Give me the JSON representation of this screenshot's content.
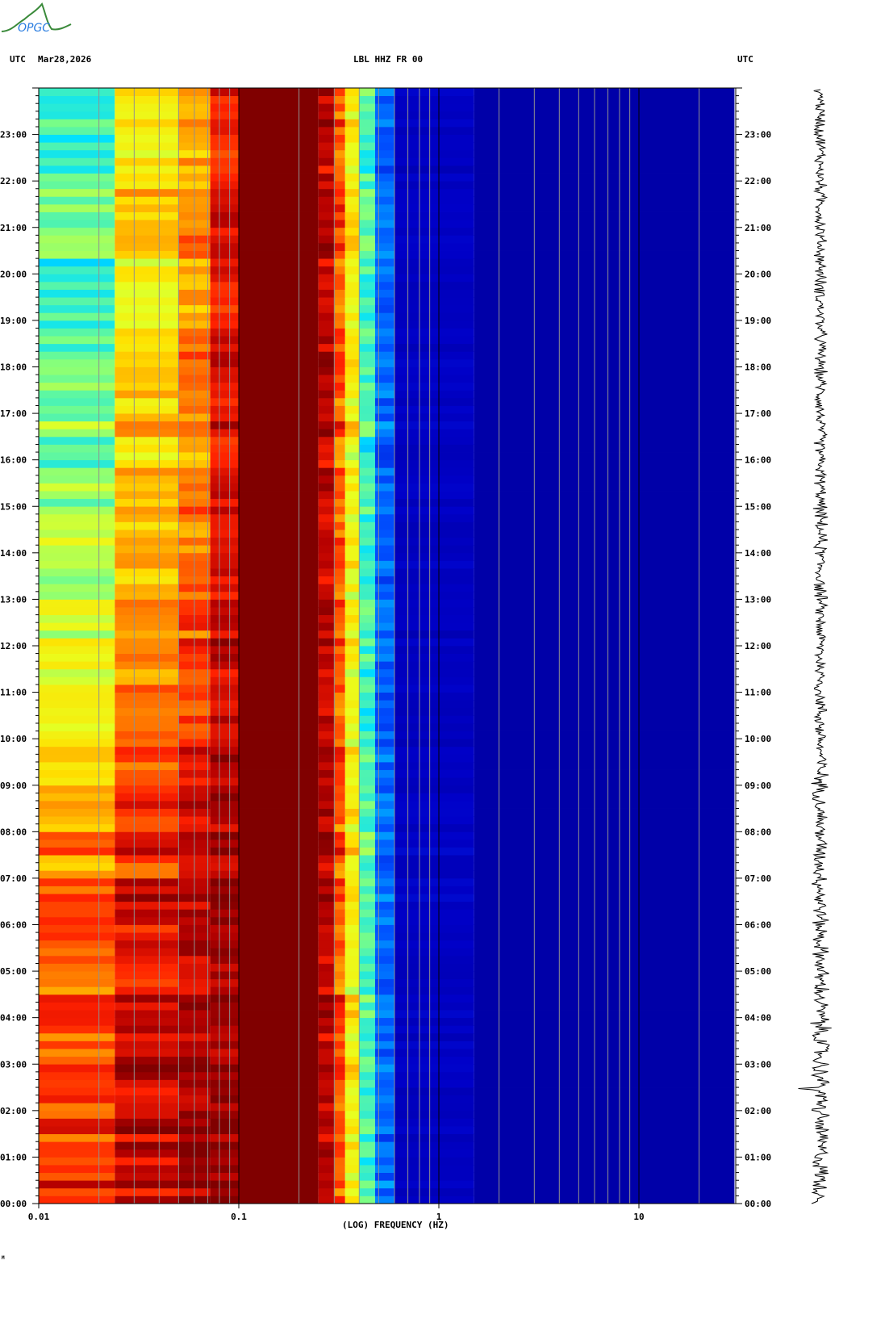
{
  "logo": {
    "text": "OPGC"
  },
  "header": {
    "left_tz": "UTC",
    "date": "Mar28,2026",
    "station": "LBL HHZ FR 00",
    "right_tz": "UTC"
  },
  "footer": {
    "mark": "M"
  },
  "chart_data": {
    "type": "heatmap",
    "title": "LBL HHZ FR 00",
    "xlabel": "(LOG) FREQUENCY (HZ)",
    "ylabel": "UTC",
    "xscale": "log",
    "xlim": [
      0.01,
      30
    ],
    "ylim_hours": [
      0,
      24
    ],
    "x_tick_labels": [
      "0.01",
      "0.1",
      "1",
      "10"
    ],
    "x_tick_values": [
      0.01,
      0.1,
      1,
      10
    ],
    "y_tick_labels": [
      "00:00",
      "01:00",
      "02:00",
      "03:00",
      "04:00",
      "05:00",
      "06:00",
      "07:00",
      "08:00",
      "09:00",
      "10:00",
      "11:00",
      "12:00",
      "13:00",
      "14:00",
      "15:00",
      "16:00",
      "17:00",
      "18:00",
      "19:00",
      "20:00",
      "21:00",
      "22:00",
      "23:00"
    ],
    "minor_tick_minutes": 10,
    "colorscale": "jet (low = dark blue, high = dark red)",
    "grid": true,
    "bands": [
      {
        "f": [
          0.01,
          0.024
        ],
        "noise": 0.08,
        "hourly_level": [
          0.86,
          0.85,
          0.85,
          0.84,
          0.84,
          0.83,
          0.8,
          0.76,
          0.72,
          0.7,
          0.67,
          0.64,
          0.6,
          0.58,
          0.56,
          0.52,
          0.5,
          0.48,
          0.47,
          0.46,
          0.45,
          0.45,
          0.44,
          0.44
        ]
      },
      {
        "f": [
          0.024,
          0.05
        ],
        "noise": 0.09,
        "hourly_level": [
          0.93,
          0.93,
          0.92,
          0.92,
          0.91,
          0.9,
          0.88,
          0.85,
          0.83,
          0.82,
          0.8,
          0.78,
          0.75,
          0.74,
          0.72,
          0.71,
          0.7,
          0.68,
          0.67,
          0.67,
          0.66,
          0.66,
          0.65,
          0.65
        ]
      },
      {
        "f": [
          0.05,
          0.072
        ],
        "noise": 0.08,
        "hourly_level": [
          0.97,
          0.97,
          0.96,
          0.96,
          0.95,
          0.94,
          0.93,
          0.91,
          0.9,
          0.89,
          0.87,
          0.85,
          0.83,
          0.82,
          0.8,
          0.8,
          0.79,
          0.78,
          0.77,
          0.76,
          0.76,
          0.75,
          0.75,
          0.74
        ]
      },
      {
        "f": [
          0.072,
          0.1
        ],
        "noise": 0.06,
        "hourly_level": [
          0.98,
          0.98,
          0.98,
          0.97,
          0.97,
          0.97,
          0.96,
          0.95,
          0.95,
          0.94,
          0.94,
          0.93,
          0.92,
          0.92,
          0.91,
          0.91,
          0.9,
          0.9,
          0.9,
          0.89,
          0.89,
          0.89,
          0.88,
          0.88
        ]
      },
      {
        "f": [
          0.1,
          0.25
        ],
        "noise": 0.0,
        "hourly_level": [
          1,
          1,
          1,
          1,
          1,
          1,
          1,
          1,
          1,
          1,
          1,
          1,
          1,
          1,
          1,
          1,
          1,
          1,
          1,
          1,
          1,
          1,
          1,
          1
        ]
      },
      {
        "f": [
          0.25,
          0.3
        ],
        "noise": 0.06,
        "hourly_level": [
          0.94,
          0.94,
          0.94,
          0.94,
          0.94,
          0.94,
          0.94,
          0.94,
          0.94,
          0.94,
          0.94,
          0.94,
          0.94,
          0.94,
          0.94,
          0.94,
          0.94,
          0.94,
          0.94,
          0.94,
          0.94,
          0.94,
          0.94,
          0.94
        ]
      },
      {
        "f": [
          0.3,
          0.34
        ],
        "noise": 0.08,
        "hourly_level": [
          0.82,
          0.82,
          0.82,
          0.82,
          0.82,
          0.82,
          0.82,
          0.82,
          0.82,
          0.82,
          0.82,
          0.82,
          0.82,
          0.82,
          0.82,
          0.82,
          0.82,
          0.82,
          0.82,
          0.82,
          0.82,
          0.82,
          0.82,
          0.82
        ]
      },
      {
        "f": [
          0.34,
          0.4
        ],
        "noise": 0.08,
        "hourly_level": [
          0.64,
          0.64,
          0.64,
          0.64,
          0.64,
          0.64,
          0.64,
          0.64,
          0.64,
          0.64,
          0.64,
          0.64,
          0.64,
          0.64,
          0.64,
          0.64,
          0.64,
          0.64,
          0.64,
          0.64,
          0.64,
          0.64,
          0.64,
          0.64
        ]
      },
      {
        "f": [
          0.4,
          0.48
        ],
        "noise": 0.07,
        "hourly_level": [
          0.45,
          0.45,
          0.45,
          0.45,
          0.45,
          0.45,
          0.45,
          0.45,
          0.45,
          0.45,
          0.45,
          0.45,
          0.45,
          0.45,
          0.45,
          0.45,
          0.45,
          0.45,
          0.45,
          0.45,
          0.45,
          0.45,
          0.45,
          0.45
        ]
      },
      {
        "f": [
          0.48,
          0.6
        ],
        "noise": 0.05,
        "hourly_level": [
          0.27,
          0.27,
          0.27,
          0.27,
          0.27,
          0.27,
          0.27,
          0.27,
          0.27,
          0.27,
          0.27,
          0.27,
          0.27,
          0.27,
          0.27,
          0.27,
          0.27,
          0.27,
          0.27,
          0.27,
          0.27,
          0.27,
          0.27,
          0.27
        ]
      },
      {
        "f": [
          0.6,
          1.5
        ],
        "noise": 0.02,
        "hourly_level": [
          0.11,
          0.11,
          0.11,
          0.11,
          0.11,
          0.11,
          0.11,
          0.11,
          0.11,
          0.11,
          0.11,
          0.11,
          0.11,
          0.11,
          0.11,
          0.11,
          0.11,
          0.11,
          0.11,
          0.11,
          0.11,
          0.11,
          0.11,
          0.11
        ]
      },
      {
        "f": [
          1.5,
          30
        ],
        "noise": 0.01,
        "hourly_level": [
          0.15,
          0.15,
          0.15,
          0.15,
          0.15,
          0.15,
          0.15,
          0.15,
          0.15,
          0.15,
          0.15,
          0.15,
          0.15,
          0.15,
          0.15,
          0.15,
          0.15,
          0.15,
          0.15,
          0.15,
          0.15,
          0.15,
          0.15,
          0.15
        ]
      }
    ],
    "waveform_relative_amplitude_hourly": [
      1.3,
      1.3,
      1.4,
      1.5,
      1.3,
      1.2,
      1.2,
      1.1,
      1.1,
      1.2,
      1.0,
      1.0,
      0.9,
      1.0,
      1.0,
      0.9,
      0.9,
      0.9,
      0.9,
      0.9,
      0.9,
      0.9,
      0.9,
      0.9
    ]
  }
}
